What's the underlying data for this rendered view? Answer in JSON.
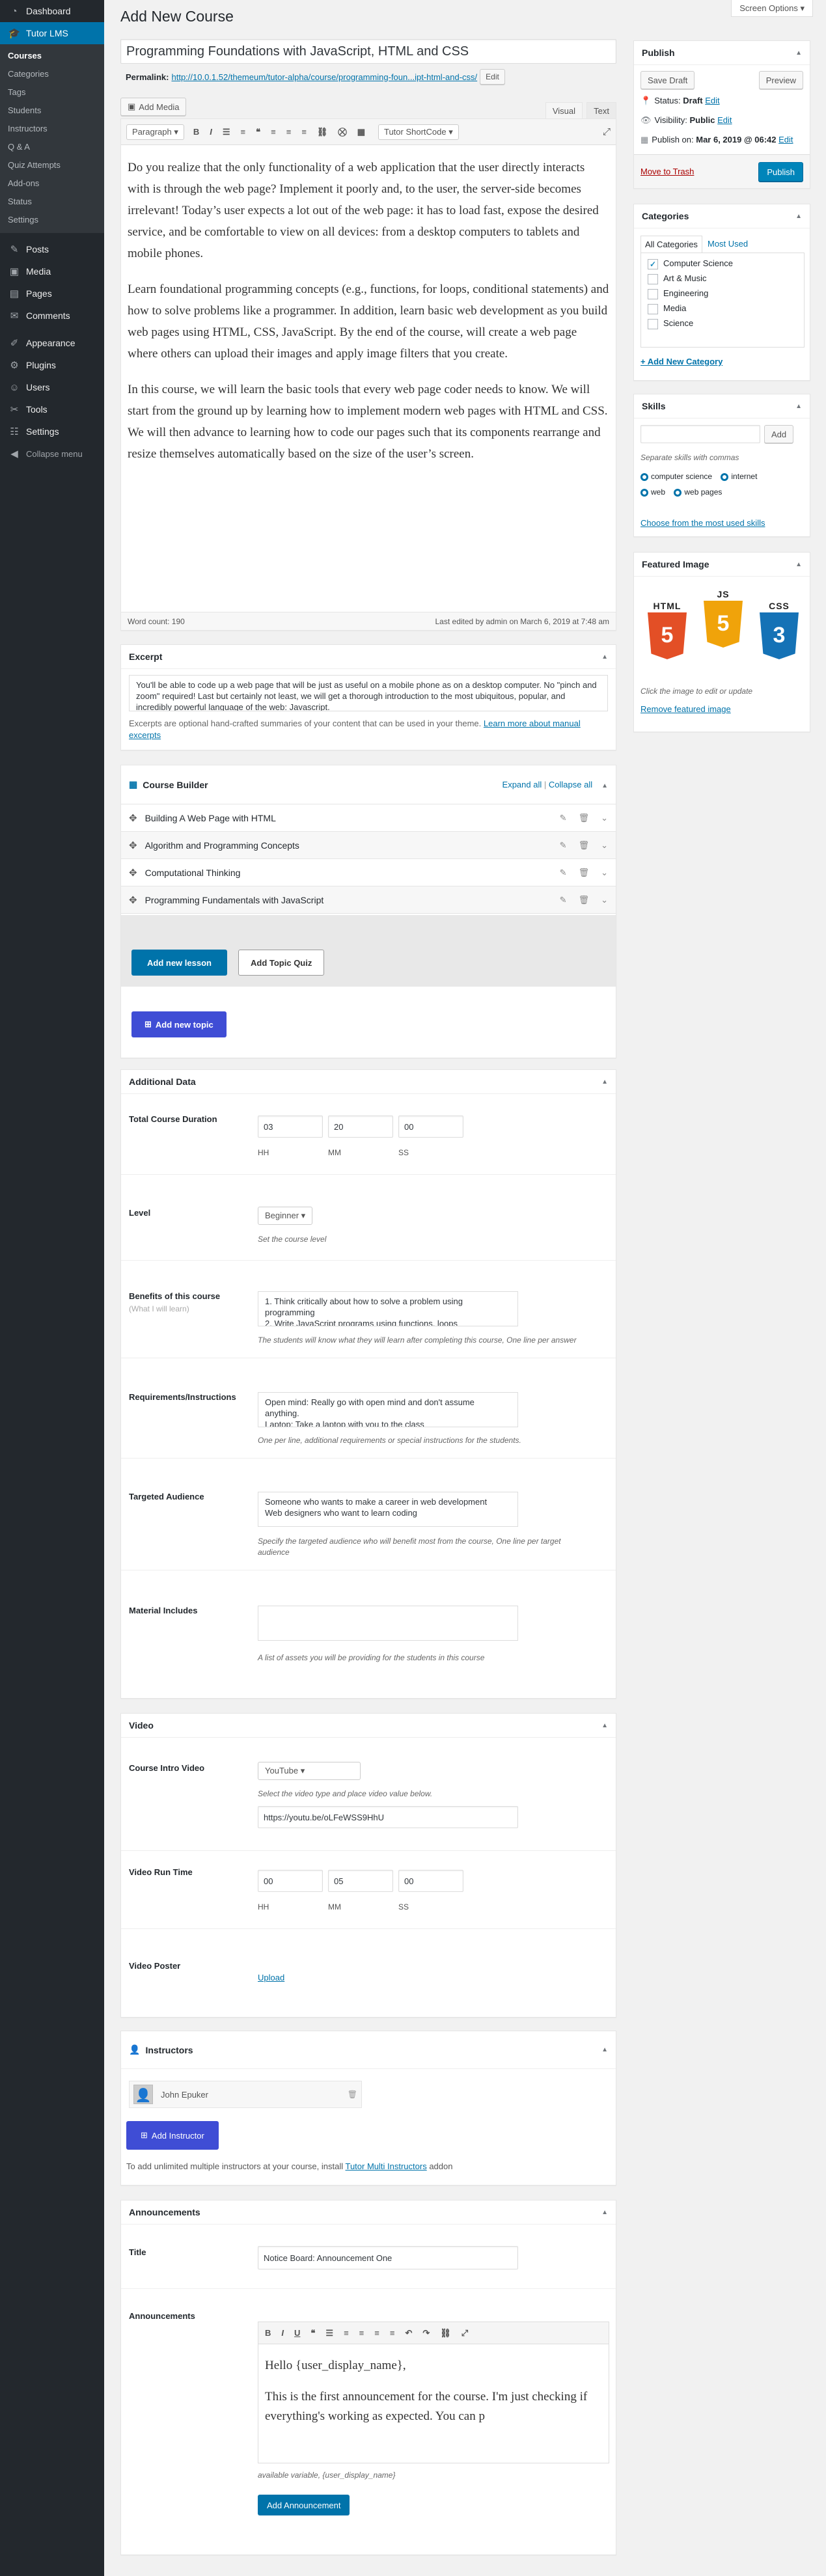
{
  "sidebar": {
    "dashboard": "Dashboard",
    "tutor": "Tutor LMS",
    "tutor_sub": [
      "Courses",
      "Categories",
      "Tags",
      "Students",
      "Instructors",
      "Q & A",
      "Quiz Attempts",
      "Add-ons",
      "Status",
      "Settings"
    ],
    "items": [
      "Posts",
      "Media",
      "Pages",
      "Comments"
    ],
    "items2": [
      "Appearance",
      "Plugins",
      "Users",
      "Tools",
      "Settings"
    ],
    "collapse": "Collapse menu"
  },
  "screen_options": "Screen Options ▾",
  "page_title": "Add New Course",
  "title_value": "Programming Foundations with JavaScript, HTML and CSS",
  "permalink": {
    "label": "Permalink:",
    "url": "http://10.0.1.52/themeum/tutor-alpha/course/programming-foun...ipt-html-and-css/",
    "edit": "Edit"
  },
  "editor": {
    "add_media": "Add Media",
    "tab_visual": "Visual",
    "tab_text": "Text",
    "format": "Paragraph ▾",
    "shortcode": "Tutor ShortCode ▾",
    "paragraphs": [
      "Do you realize that the only functionality of a web application that the user directly interacts with is through the web page? Implement it poorly and, to the user, the server-side becomes irrelevant! Today’s user expects a lot out of the web page: it has to load fast, expose the desired service, and be comfortable to view on all devices: from a desktop computers to tablets and mobile phones.",
      "Learn foundational programming concepts (e.g., functions, for loops, conditional statements) and how to solve problems like a programmer. In addition, learn basic web development as you build web pages using HTML, CSS, JavaScript. By the end of the course, will create a web page where others can upload their images and apply image filters that you create.",
      "In this course, we will learn the basic tools that every web page coder needs to know. We will start from the ground up by learning how to implement modern web pages with HTML and CSS. We will then advance to learning how to code our pages such that its components rearrange and resize themselves automatically based on the size of the user’s screen."
    ],
    "word_count": "Word count: 190",
    "last_edited": "Last edited by admin on March 6, 2019 at 7:48 am"
  },
  "excerpt": {
    "title": "Excerpt",
    "text": "You'll be able to code up a web page that will be just as useful on a mobile phone as on a desktop computer. No \"pinch and zoom\" required! Last but certainly not least, we will get a thorough introduction to the most ubiquitous, popular, and incredibly powerful language of the web: Javascript.",
    "help": "Excerpts are optional hand-crafted summaries of your content that can be used in your theme.",
    "help_link": "Learn more about manual excerpts"
  },
  "course_builder": {
    "title": "Course Builder",
    "expand": "Expand all",
    "collapse": "Collapse all",
    "divider": "|",
    "topics": [
      "Building A Web Page with HTML",
      "Algorithm and Programming Concepts",
      "Computational Thinking",
      "Programming Fundamentals with JavaScript"
    ],
    "add_lesson": "Add new lesson",
    "add_quiz": "Add Topic Quiz",
    "add_topic": "Add new topic"
  },
  "additional": {
    "title": "Additional Data",
    "duration_label": "Total Course Duration",
    "hh": "03",
    "mm": "20",
    "ss": "00",
    "hh_l": "HH",
    "mm_l": "MM",
    "ss_l": "SS",
    "level_label": "Level",
    "level_value": "Beginner ▾",
    "level_desc": "Set the course level",
    "benefits_label": "Benefits of this course",
    "benefits_sub": "(What I will learn)",
    "benefits_value": "1. Think critically about how to solve a problem using programming\n2. Write JavaScript programs using functions, loops",
    "benefits_desc": "The students will know what they will learn after completing this course, One line per answer",
    "req_label": "Requirements/Instructions",
    "req_value": "Open mind: Really go with open mind and don't assume anything.\nLaptop: Take a laptop with you to the class",
    "req_desc": "One per line, additional requirements or special instructions for the students.",
    "aud_label": "Targeted Audience",
    "aud_value": "Someone who wants to make a career in web development\nWeb designers who want to learn coding",
    "aud_desc": "Specify the targeted audience who will benefit most from the course, One line per target audience",
    "mat_label": "Material Includes",
    "mat_desc": "A list of assets you will be providing for the students in this course"
  },
  "video": {
    "title": "Video",
    "intro_label": "Course Intro Video",
    "source": "YouTube ▾",
    "source_desc": "Select the video type and place video value below.",
    "url": "https://youtu.be/oLFeWSS9HhU",
    "run_label": "Video Run Time",
    "hh": "00",
    "mm": "05",
    "ss": "00",
    "hh_l": "HH",
    "mm_l": "MM",
    "ss_l": "SS",
    "poster_label": "Video Poster",
    "upload": "Upload"
  },
  "instructors": {
    "title": "Instructors",
    "name": "John Epuker",
    "add": "Add Instructor",
    "note": "To add unlimited multiple instructors at your course, install",
    "note_link": "Tutor Multi Instructors",
    "note_end": "addon"
  },
  "announcements": {
    "title": "Announcements",
    "title_label": "Title",
    "title_value": "Notice Board: Announcement One",
    "ann_label": "Announcements",
    "hello": "Hello {user_display_name},",
    "body": "This is the first announcement for the course. I'm just checking if everything's working as expected. You can p",
    "variable": "available variable, {user_display_name}",
    "add": "Add Announcement"
  },
  "publish": {
    "title": "Publish",
    "save_draft": "Save Draft",
    "preview": "Preview",
    "status_label": "Status:",
    "status_value": "Draft",
    "status_edit": "Edit",
    "vis_label": "Visibility:",
    "vis_value": "Public",
    "vis_edit": "Edit",
    "pub_label": "Publish on:",
    "pub_value": "Mar 6, 2019 @ 06:42",
    "pub_edit": "Edit",
    "trash": "Move to Trash",
    "publish": "Publish"
  },
  "categories": {
    "title": "Categories",
    "tab_all": "All Categories",
    "tab_used": "Most Used",
    "items": [
      {
        "name": "Computer Science",
        "checked": true
      },
      {
        "name": "Art & Music",
        "checked": false
      },
      {
        "name": "Engineering",
        "checked": false
      },
      {
        "name": "Media",
        "checked": false
      },
      {
        "name": "Science",
        "checked": false
      }
    ],
    "check": "✓",
    "add_new": "+ Add New Category"
  },
  "skills": {
    "title": "Skills",
    "add": "Add",
    "hint": "Separate skills with commas",
    "tags": [
      "computer science",
      "internet",
      "web",
      "web pages"
    ],
    "choose": "Choose from the most used skills"
  },
  "featured": {
    "title": "Featured Image",
    "html": "HTML",
    "js": "JS",
    "css": "CSS",
    "n5": "5",
    "n3": "3",
    "hint": "Click the image to edit or update",
    "remove": "Remove featured image"
  },
  "colors": {
    "accent": "#0073aa",
    "sidebar": "#23282d",
    "primary_btn": "#0085ba",
    "trash": "#a00"
  }
}
